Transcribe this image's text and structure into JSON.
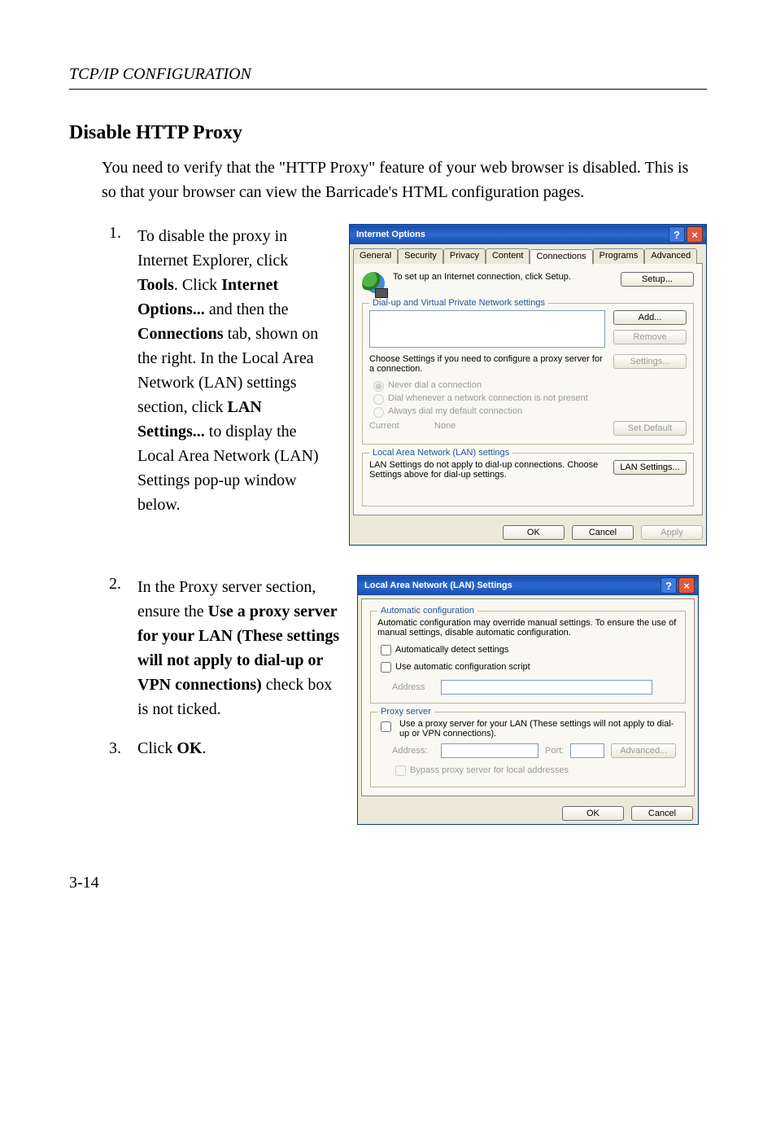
{
  "header": {
    "title": "TCP/IP CONFIGURATION"
  },
  "section": {
    "title": "Disable HTTP Proxy",
    "intro": "You need to verify that the \"HTTP Proxy\" feature of your web browser is disabled. This is so that your browser can view the Barricade's HTML configuration pages."
  },
  "steps": {
    "s1": {
      "num": "1.",
      "t1": "To disable the proxy in Internet Explorer, click ",
      "b1": "Tools",
      "t2": ". Click ",
      "b2": "Internet Options...",
      "t3": " and then the ",
      "b3": "Connections",
      "t4": " tab, shown on the right. In the Local Area Network (LAN) settings section, click ",
      "b4": "LAN Settings...",
      "t5": " to display the Local Area Network (LAN) Settings pop-up window below."
    },
    "s2": {
      "num": "2.",
      "t1": "In the Proxy server section, ensure the ",
      "b1": "Use a proxy server for your LAN (These settings will not apply to dial-up or VPN connections)",
      "t2": " check box is not ticked."
    },
    "s3": {
      "num": "3.",
      "t1": "Click ",
      "b1": "OK",
      "t2": "."
    }
  },
  "io_dialog": {
    "title": "Internet Options",
    "tabs": {
      "general": "General",
      "security": "Security",
      "privacy": "Privacy",
      "content": "Content",
      "connections": "Connections",
      "programs": "Programs",
      "advanced": "Advanced"
    },
    "setup_text": "To set up an Internet connection, click Setup.",
    "setup_btn": "Setup...",
    "dialup_legend": "Dial-up and Virtual Private Network settings",
    "add_btn": "Add...",
    "remove_btn": "Remove",
    "choose_text": "Choose Settings if you need to configure a proxy server for a connection.",
    "settings_btn": "Settings...",
    "radio_never": "Never dial a connection",
    "radio_whenever": "Dial whenever a network connection is not present",
    "radio_always": "Always dial my default connection",
    "current_label": "Current",
    "current_value": "None",
    "set_default_btn": "Set Default",
    "lan_legend": "Local Area Network (LAN) settings",
    "lan_text": "LAN Settings do not apply to dial-up connections. Choose Settings above for dial-up settings.",
    "lan_btn": "LAN Settings...",
    "ok": "OK",
    "cancel": "Cancel",
    "apply": "Apply"
  },
  "lan_dialog": {
    "title": "Local Area Network (LAN) Settings",
    "auto_legend": "Automatic configuration",
    "auto_text": "Automatic configuration may override manual settings.  To ensure the use of manual settings, disable automatic configuration.",
    "auto_detect": "Automatically detect settings",
    "auto_script": "Use automatic configuration script",
    "address_label": "Address",
    "proxy_legend": "Proxy server",
    "proxy_text": "Use a proxy server for your LAN (These settings will not apply to dial-up or VPN connections).",
    "addr2_label": "Address:",
    "port_label": "Port:",
    "advanced_btn": "Advanced...",
    "bypass": "Bypass proxy server for local addresses",
    "ok": "OK",
    "cancel": "Cancel"
  },
  "page_number": "3-14"
}
